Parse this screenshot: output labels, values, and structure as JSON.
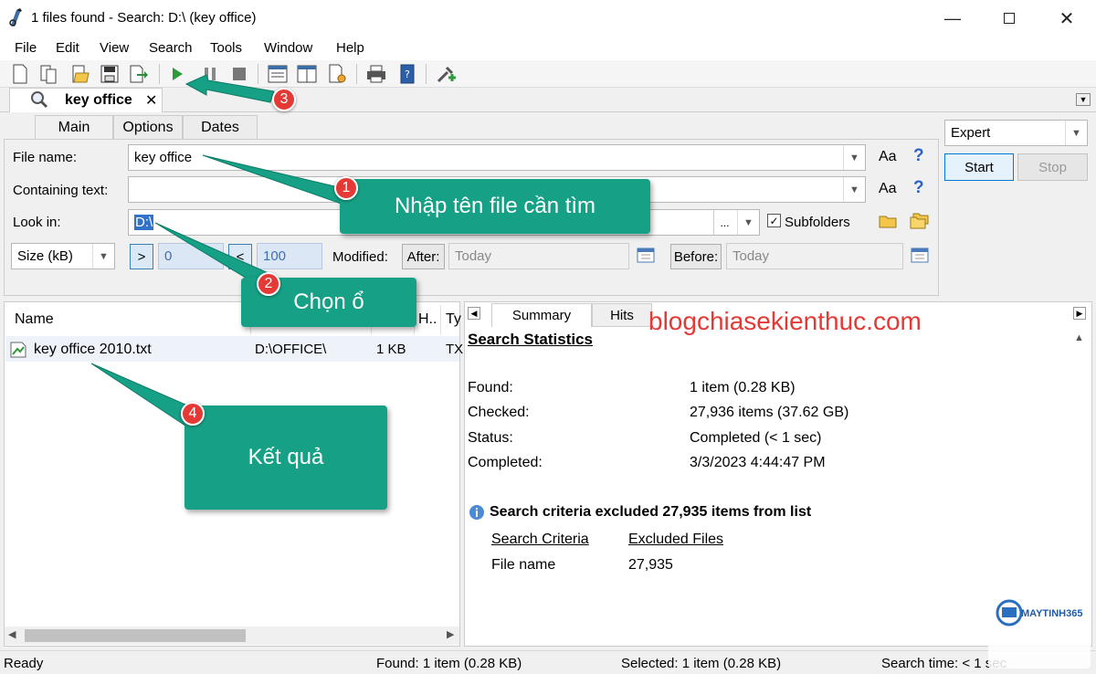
{
  "window": {
    "title": "1 files found - Search: D:\\ (key office)"
  },
  "menu": [
    "File",
    "Edit",
    "View",
    "Search",
    "Tools",
    "Window",
    "Help"
  ],
  "doc_tab": {
    "label": "key office"
  },
  "inner_tabs": [
    "Main",
    "Options",
    "Dates"
  ],
  "form": {
    "file_name_label": "File name:",
    "file_name_value": "key office",
    "containing_label": "Containing text:",
    "containing_value": "",
    "look_in_label": "Look in:",
    "look_in_value": "D:\\",
    "browse_label": "...",
    "subfolders_label": "Subfolders",
    "size_select": "Size (kB)",
    "size_min_op": ">",
    "size_min": "0",
    "size_max_op": "<",
    "size_max": "100",
    "modified_label": "Modified:",
    "after_label": "After:",
    "after_value": "Today",
    "before_label": "Before:",
    "before_value": "Today",
    "case_label": "Aa",
    "help_label": "?"
  },
  "mode": {
    "selected": "Expert",
    "start": "Start",
    "stop": "Stop"
  },
  "results": {
    "columns": [
      "Name",
      "H..",
      "Ty"
    ],
    "rows": [
      {
        "name": "key office 2010.txt",
        "path": "D:\\OFFICE\\",
        "size": "1 KB",
        "type": "TX"
      }
    ]
  },
  "summary": {
    "tabs": [
      "Summary",
      "Hits"
    ],
    "title": "Search Statistics",
    "stats": [
      {
        "label": "Found:",
        "value": "1 item (0.28 KB)"
      },
      {
        "label": "Checked:",
        "value": "27,936 items (37.62 GB)"
      },
      {
        "label": "Status:",
        "value": "Completed (< 1 sec)"
      },
      {
        "label": "Completed:",
        "value": "3/3/2023 4:44:47 PM"
      }
    ],
    "excluded_title": "Search criteria excluded 27,935 items from list",
    "excluded_head": [
      "Search Criteria",
      "Excluded Files"
    ],
    "excluded_row": [
      "File name",
      "27,935"
    ]
  },
  "status": {
    "ready": "Ready",
    "found": "Found: 1 item (0.28 KB)",
    "selected": "Selected: 1 item (0.28 KB)",
    "time": "Search time: < 1 sec"
  },
  "callouts": {
    "c1": {
      "num": "1",
      "text": "Nhập tên file cần tìm"
    },
    "c2": {
      "num": "2",
      "text": "Chọn ổ"
    },
    "c3": {
      "num": "3"
    },
    "c4": {
      "num": "4",
      "text": "Kết quả"
    }
  },
  "watermark": "blogchiasekienthuc.com",
  "logo_text": "MAYTINH365",
  "colors": {
    "callout": "#16a085",
    "badge": "#e53935",
    "watermark": "#e53935"
  }
}
